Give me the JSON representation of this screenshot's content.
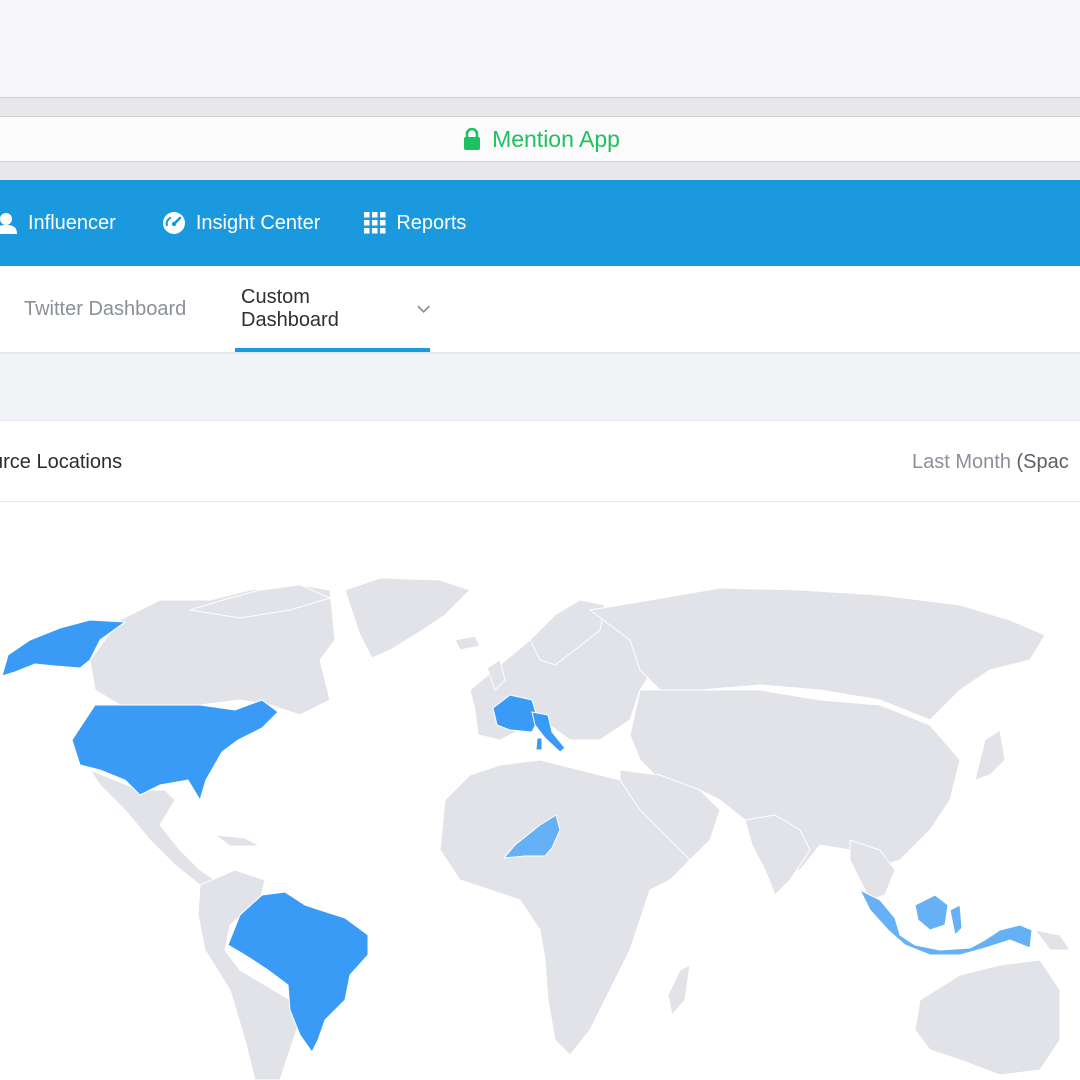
{
  "browser": {
    "site_title": "Mention App"
  },
  "nav": {
    "items": [
      {
        "label": "Influencer",
        "icon": "user-icon"
      },
      {
        "label": "Insight Center",
        "icon": "gauge-icon"
      },
      {
        "label": "Reports",
        "icon": "grid-icon"
      }
    ],
    "background_color": "#1a99df"
  },
  "tabs": {
    "twitter": "Twitter Dashboard",
    "custom": "Custom Dashboard",
    "active": "Custom Dashboard"
  },
  "panel": {
    "title": "urce Locations",
    "range_label": "Last Month",
    "range_suffix": "(Spac"
  },
  "map": {
    "highlight_color": "#3a9bf6",
    "light_highlight_color": "#66b0f5",
    "land_color": "#e1e3e9",
    "highlighted_countries": [
      "United States",
      "Alaska (US)",
      "Brazil",
      "France",
      "Italy",
      "Niger",
      "Indonesia"
    ]
  }
}
